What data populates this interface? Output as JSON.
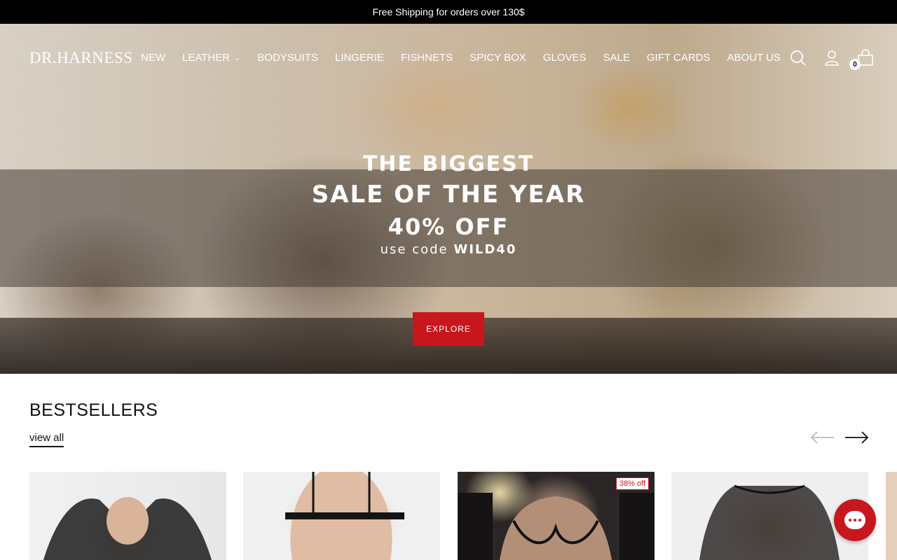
{
  "announcement": "Free Shipping for orders over 130$",
  "brand": "DR.HARNESS",
  "nav": {
    "items": [
      {
        "label": "NEW"
      },
      {
        "label": "LEATHER",
        "has_dropdown": true
      },
      {
        "label": "BODYSUITS"
      },
      {
        "label": "LINGERIE"
      },
      {
        "label": "FISHNETS"
      },
      {
        "label": "SPICY BOX"
      },
      {
        "label": "GLOVES"
      },
      {
        "label": "SALE"
      },
      {
        "label": "GIFT CARDS"
      },
      {
        "label": "ABOUT US"
      }
    ],
    "icons": [
      "search-icon",
      "account-icon",
      "cart-icon"
    ],
    "cart_count": "0"
  },
  "hero": {
    "line1": "THE BIGGEST",
    "line2": "SALE OF THE YEAR",
    "line3": "40% OFF",
    "line4_prefix": "use code ",
    "line4_code": "WILD40",
    "cta": "EXPLORE"
  },
  "bestsellers": {
    "title": "BESTSELLERS",
    "view_all": "view all",
    "products": [
      {
        "badge": ""
      },
      {
        "badge": ""
      },
      {
        "badge": "38% off"
      },
      {
        "badge": ""
      },
      {
        "badge": ""
      }
    ]
  },
  "colors": {
    "accent": "#c8171c",
    "announcement_bg": "#000000"
  }
}
